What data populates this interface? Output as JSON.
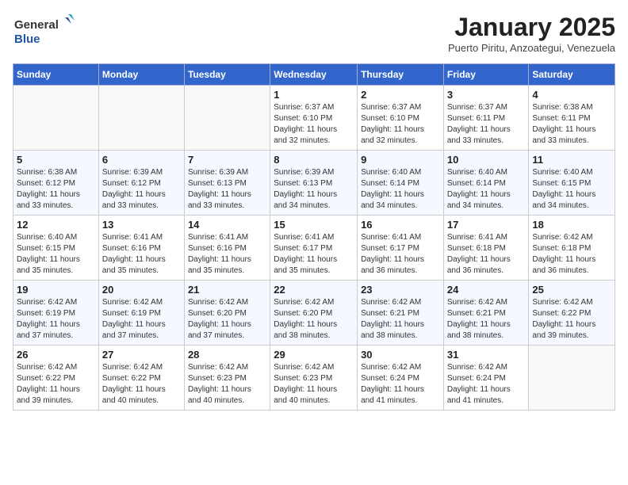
{
  "header": {
    "logo_general": "General",
    "logo_blue": "Blue",
    "month_title": "January 2025",
    "subtitle": "Puerto Piritu, Anzoategui, Venezuela"
  },
  "days_of_week": [
    "Sunday",
    "Monday",
    "Tuesday",
    "Wednesday",
    "Thursday",
    "Friday",
    "Saturday"
  ],
  "weeks": [
    [
      {
        "day": "",
        "info": ""
      },
      {
        "day": "",
        "info": ""
      },
      {
        "day": "",
        "info": ""
      },
      {
        "day": "1",
        "info": "Sunrise: 6:37 AM\nSunset: 6:10 PM\nDaylight: 11 hours\nand 32 minutes."
      },
      {
        "day": "2",
        "info": "Sunrise: 6:37 AM\nSunset: 6:10 PM\nDaylight: 11 hours\nand 32 minutes."
      },
      {
        "day": "3",
        "info": "Sunrise: 6:37 AM\nSunset: 6:11 PM\nDaylight: 11 hours\nand 33 minutes."
      },
      {
        "day": "4",
        "info": "Sunrise: 6:38 AM\nSunset: 6:11 PM\nDaylight: 11 hours\nand 33 minutes."
      }
    ],
    [
      {
        "day": "5",
        "info": "Sunrise: 6:38 AM\nSunset: 6:12 PM\nDaylight: 11 hours\nand 33 minutes."
      },
      {
        "day": "6",
        "info": "Sunrise: 6:39 AM\nSunset: 6:12 PM\nDaylight: 11 hours\nand 33 minutes."
      },
      {
        "day": "7",
        "info": "Sunrise: 6:39 AM\nSunset: 6:13 PM\nDaylight: 11 hours\nand 33 minutes."
      },
      {
        "day": "8",
        "info": "Sunrise: 6:39 AM\nSunset: 6:13 PM\nDaylight: 11 hours\nand 34 minutes."
      },
      {
        "day": "9",
        "info": "Sunrise: 6:40 AM\nSunset: 6:14 PM\nDaylight: 11 hours\nand 34 minutes."
      },
      {
        "day": "10",
        "info": "Sunrise: 6:40 AM\nSunset: 6:14 PM\nDaylight: 11 hours\nand 34 minutes."
      },
      {
        "day": "11",
        "info": "Sunrise: 6:40 AM\nSunset: 6:15 PM\nDaylight: 11 hours\nand 34 minutes."
      }
    ],
    [
      {
        "day": "12",
        "info": "Sunrise: 6:40 AM\nSunset: 6:15 PM\nDaylight: 11 hours\nand 35 minutes."
      },
      {
        "day": "13",
        "info": "Sunrise: 6:41 AM\nSunset: 6:16 PM\nDaylight: 11 hours\nand 35 minutes."
      },
      {
        "day": "14",
        "info": "Sunrise: 6:41 AM\nSunset: 6:16 PM\nDaylight: 11 hours\nand 35 minutes."
      },
      {
        "day": "15",
        "info": "Sunrise: 6:41 AM\nSunset: 6:17 PM\nDaylight: 11 hours\nand 35 minutes."
      },
      {
        "day": "16",
        "info": "Sunrise: 6:41 AM\nSunset: 6:17 PM\nDaylight: 11 hours\nand 36 minutes."
      },
      {
        "day": "17",
        "info": "Sunrise: 6:41 AM\nSunset: 6:18 PM\nDaylight: 11 hours\nand 36 minutes."
      },
      {
        "day": "18",
        "info": "Sunrise: 6:42 AM\nSunset: 6:18 PM\nDaylight: 11 hours\nand 36 minutes."
      }
    ],
    [
      {
        "day": "19",
        "info": "Sunrise: 6:42 AM\nSunset: 6:19 PM\nDaylight: 11 hours\nand 37 minutes."
      },
      {
        "day": "20",
        "info": "Sunrise: 6:42 AM\nSunset: 6:19 PM\nDaylight: 11 hours\nand 37 minutes."
      },
      {
        "day": "21",
        "info": "Sunrise: 6:42 AM\nSunset: 6:20 PM\nDaylight: 11 hours\nand 37 minutes."
      },
      {
        "day": "22",
        "info": "Sunrise: 6:42 AM\nSunset: 6:20 PM\nDaylight: 11 hours\nand 38 minutes."
      },
      {
        "day": "23",
        "info": "Sunrise: 6:42 AM\nSunset: 6:21 PM\nDaylight: 11 hours\nand 38 minutes."
      },
      {
        "day": "24",
        "info": "Sunrise: 6:42 AM\nSunset: 6:21 PM\nDaylight: 11 hours\nand 38 minutes."
      },
      {
        "day": "25",
        "info": "Sunrise: 6:42 AM\nSunset: 6:22 PM\nDaylight: 11 hours\nand 39 minutes."
      }
    ],
    [
      {
        "day": "26",
        "info": "Sunrise: 6:42 AM\nSunset: 6:22 PM\nDaylight: 11 hours\nand 39 minutes."
      },
      {
        "day": "27",
        "info": "Sunrise: 6:42 AM\nSunset: 6:22 PM\nDaylight: 11 hours\nand 40 minutes."
      },
      {
        "day": "28",
        "info": "Sunrise: 6:42 AM\nSunset: 6:23 PM\nDaylight: 11 hours\nand 40 minutes."
      },
      {
        "day": "29",
        "info": "Sunrise: 6:42 AM\nSunset: 6:23 PM\nDaylight: 11 hours\nand 40 minutes."
      },
      {
        "day": "30",
        "info": "Sunrise: 6:42 AM\nSunset: 6:24 PM\nDaylight: 11 hours\nand 41 minutes."
      },
      {
        "day": "31",
        "info": "Sunrise: 6:42 AM\nSunset: 6:24 PM\nDaylight: 11 hours\nand 41 minutes."
      },
      {
        "day": "",
        "info": ""
      }
    ]
  ]
}
